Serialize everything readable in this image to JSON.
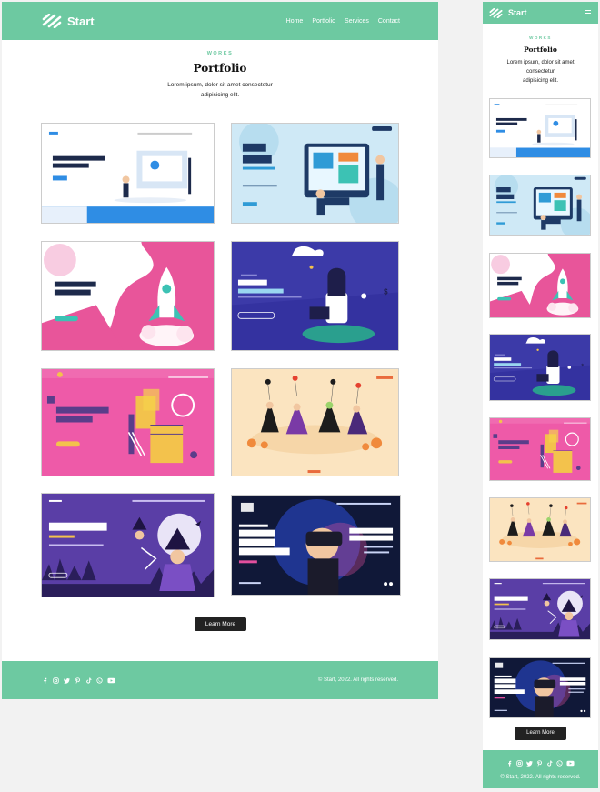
{
  "colors": {
    "brand": "#6dc9a1",
    "dark_button": "#222222",
    "page_bg": "#f2f2f2"
  },
  "header": {
    "logo_text": "Start",
    "nav": [
      "Home",
      "Portfolio",
      "Services",
      "Contact"
    ],
    "mobile_menu_icon": "hamburger-icon"
  },
  "section": {
    "eyebrow": "WORKS",
    "title": "Portfolio",
    "description_line1": "Lorem ipsum, dolor sit amet consectetur",
    "description_line2": "adipisicing elit.",
    "mobile_description_line1": "Lorem ipsum, dolor sit amet",
    "mobile_description_line2": "consectetur",
    "mobile_description_line3": "adipisicing elit."
  },
  "portfolio": [
    {
      "title": "Landing Page Design"
    },
    {
      "title": "Web Design",
      "subtitle": "LANDING PAGE"
    },
    {
      "title": "Rocket Your Business",
      "button": "MORE"
    },
    {
      "title": "Shopping",
      "subtitle": "Sample text here"
    },
    {
      "title": "Geometric shapes"
    },
    {
      "title": "TRICK OR TREAT!"
    },
    {
      "title": "HALLOWEEN",
      "subtitle": "LANDING PAGE"
    },
    {
      "eyebrow": "NEW RELEASE",
      "title_lines": [
        "VIRTUAL",
        "REALITY",
        "EXPERIENCE"
      ],
      "offer_line1": "DISCOUNT",
      "offer_line2": "UP TO 50% OFF",
      "cta": "BUY NOW"
    }
  ],
  "actions": {
    "learn_more": "Learn More"
  },
  "footer": {
    "social_icons": [
      "facebook-icon",
      "instagram-icon",
      "twitter-icon",
      "pinterest-icon",
      "tiktok-icon",
      "whatsapp-icon",
      "youtube-icon"
    ],
    "copyright": "© Start, 2022. All rights reserved."
  }
}
